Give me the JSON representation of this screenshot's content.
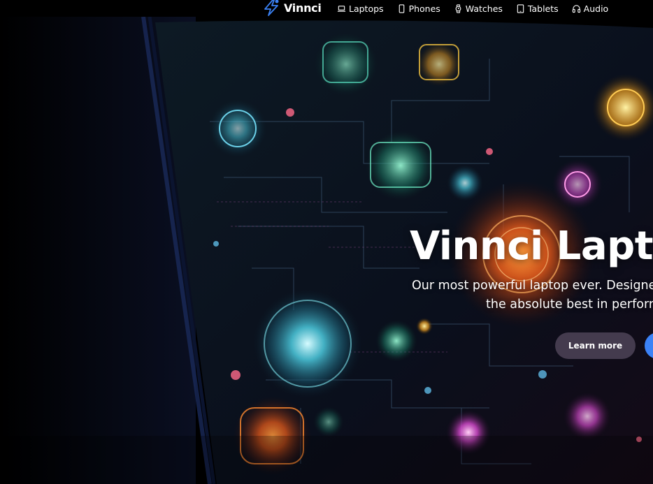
{
  "brand": {
    "name": "Vinnci",
    "icon": "lightning-bolt-icon",
    "icon_color": "#3b82f6"
  },
  "nav": {
    "items": [
      {
        "label": "Laptops",
        "icon": "laptop-icon"
      },
      {
        "label": "Phones",
        "icon": "phone-icon"
      },
      {
        "label": "Watches",
        "icon": "watch-icon"
      },
      {
        "label": "Tablets",
        "icon": "tablet-icon"
      },
      {
        "label": "Audio",
        "icon": "headphones-icon"
      }
    ]
  },
  "hero": {
    "title": "Vinnci Lapto",
    "subtitle_line1": "Our most powerful laptop ever. Designe",
    "subtitle_line2": "the absolute best in perforr",
    "learn_more_label": "Learn more",
    "primary_button_color": "#3b82f6",
    "learn_more_bg": "#4e4458"
  }
}
